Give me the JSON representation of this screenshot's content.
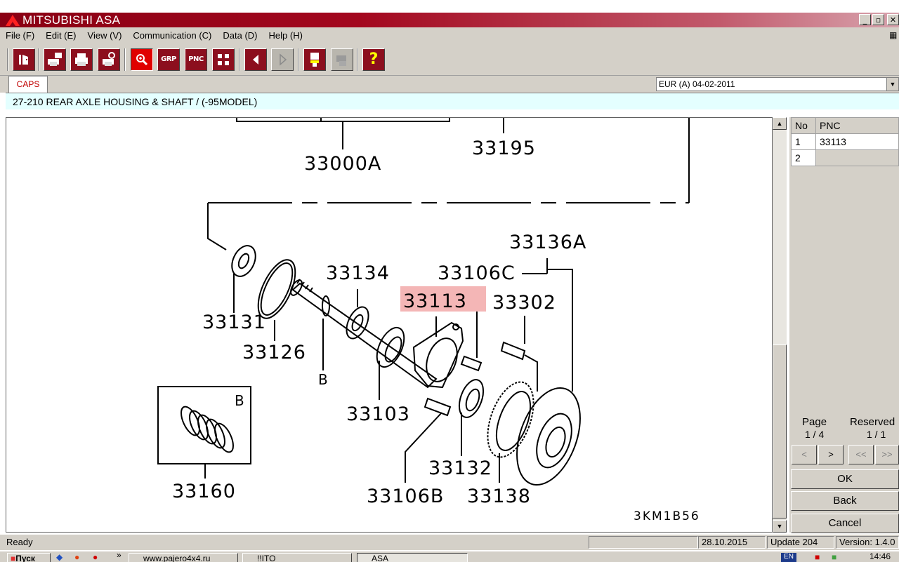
{
  "window": {
    "title": "MITSUBISHI ASA"
  },
  "menu": [
    "File (F)",
    "Edit (E)",
    "View (V)",
    "Communication (C)",
    "Data (D)",
    "Help (H)"
  ],
  "toolbar": {
    "grp": "GRP",
    "pnc": "PNC",
    "help": "?"
  },
  "caps": {
    "tab": "CAPS",
    "catalog": "EUR (A)  04-02-2011"
  },
  "group": {
    "title": "27-210  REAR AXLE HOUSING & SHAFT / (-95MODEL)"
  },
  "diagram": {
    "labels": {
      "p33000A": "33000A",
      "p33195": "33195",
      "p33136A": "33136A",
      "p33134": "33134",
      "p33106C": "33106C",
      "p33113": "33113",
      "p33302": "33302",
      "p33131": "33131",
      "p33126": "33126",
      "pB": "B",
      "p33103": "33103",
      "p33132": "33132",
      "p33106B": "33106B",
      "p33138": "33138",
      "p33160": "33160",
      "insetB": "B",
      "code": "3KM1B56"
    },
    "highlight_color": "#f4b6b6"
  },
  "pnc_table": {
    "headers": {
      "no": "No",
      "pnc": "PNC"
    },
    "rows": [
      {
        "no": "1",
        "pnc": "33113"
      },
      {
        "no": "2",
        "pnc": ""
      }
    ]
  },
  "paging": {
    "page_label": "Page",
    "page_value": "1 / 4",
    "reserved_label": "Reserved",
    "reserved_value": "1 / 1",
    "prev": "<",
    "next": ">",
    "first": "<<",
    "last": ">>"
  },
  "buttons": {
    "ok": "OK",
    "back": "Back",
    "cancel": "Cancel"
  },
  "status": {
    "state": "Ready",
    "date": "28.10.2015",
    "update": "Update 204",
    "version": "Version: 1.4.0"
  },
  "taskbar": {
    "start": "Пуск",
    "more": "»",
    "task1": "www.pajero4x4.ru",
    "task2": "!!ITO",
    "task3": "ASA",
    "lang": "EN",
    "clock": "14:46"
  }
}
